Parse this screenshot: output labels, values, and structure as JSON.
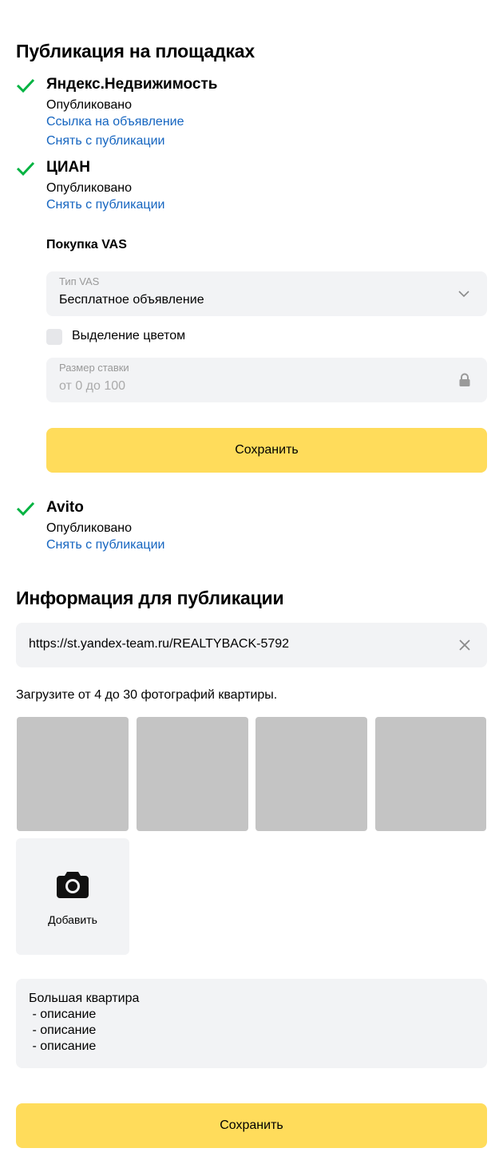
{
  "publication": {
    "title": "Публикация на площадках",
    "platforms": [
      {
        "name": "Яндекс.Недвижимость",
        "status": "Опубликовано",
        "links": [
          "Ссылка на объявление",
          "Снять с публикации"
        ]
      },
      {
        "name": "ЦИАН",
        "status": "Опубликовано",
        "links": [
          "Снять с публикации"
        ]
      },
      {
        "name": "Avito",
        "status": "Опубликовано",
        "links": [
          "Снять с публикации"
        ]
      }
    ],
    "vas": {
      "title": "Покупка VAS",
      "type_label": "Тип VAS",
      "type_value": "Бесплатное объявление",
      "highlight_label": "Выделение цветом",
      "highlight_checked": false,
      "bid_label": "Размер ставки",
      "bid_placeholder": "от 0 до 100",
      "save_label": "Сохранить"
    }
  },
  "info": {
    "title": "Информация для публикации",
    "url_value": "https://st.yandex-team.ru/REALTYBACK-5792",
    "photos_hint": "Загрузите от 4 до 30 фотографий квартиры.",
    "photo_count": 4,
    "add_label": "Добавить",
    "description_lines": [
      "Большая квартира",
      " - описание",
      " - описание",
      " - описание"
    ],
    "save_label": "Сохранить"
  },
  "colors": {
    "accent_yellow": "#ffdc5b",
    "link_blue": "#1565c0",
    "check_green": "#00b341",
    "field_bg": "#f2f3f5"
  },
  "icons": [
    "checkmark-icon",
    "chevron-down-icon",
    "lock-icon",
    "close-icon",
    "camera-icon"
  ]
}
